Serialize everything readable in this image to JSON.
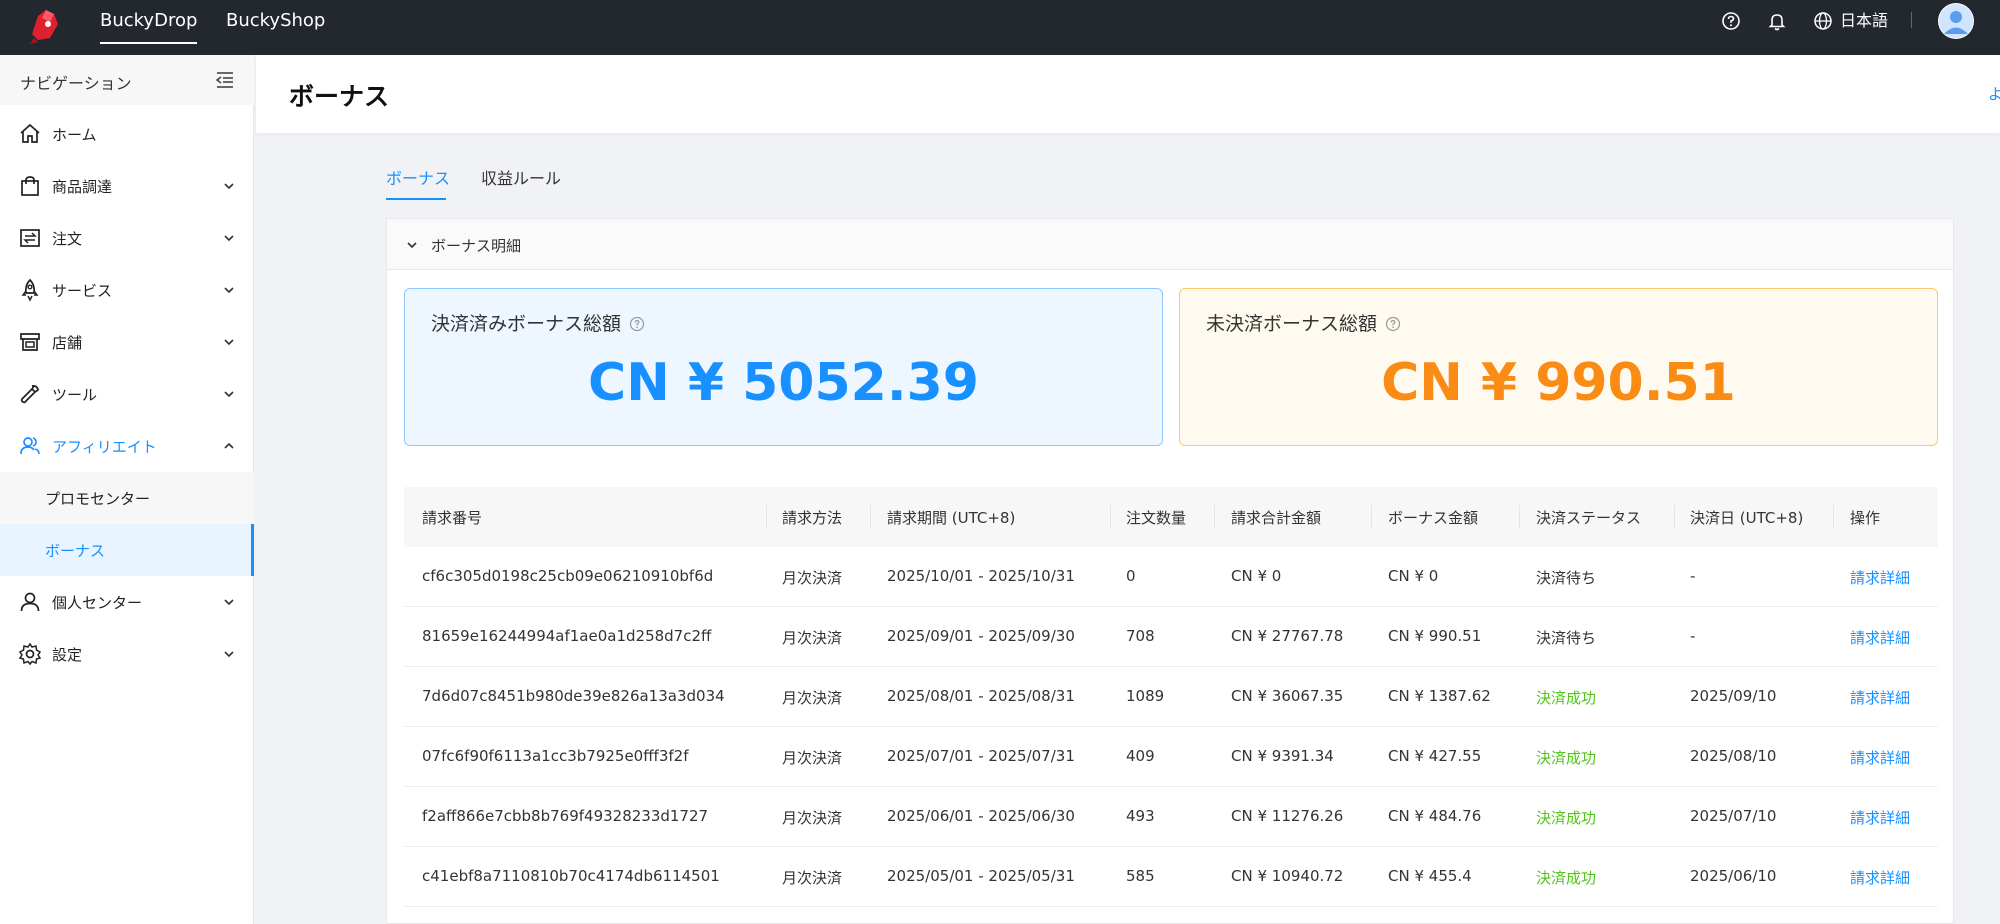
{
  "top_nav": {
    "items": [
      {
        "label": "BuckyDrop",
        "active": true
      },
      {
        "label": "BuckyShop",
        "active": false
      }
    ],
    "language": "日本語"
  },
  "sidebar": {
    "title": "ナビゲーション",
    "items": [
      {
        "label": "ホーム",
        "icon": "home-icon",
        "has_children": false
      },
      {
        "label": "商品調達",
        "icon": "shopping-bag-icon",
        "has_children": true
      },
      {
        "label": "注文",
        "icon": "order-icon",
        "has_children": true
      },
      {
        "label": "サービス",
        "icon": "rocket-icon",
        "has_children": true
      },
      {
        "label": "店舗",
        "icon": "store-icon",
        "has_children": true
      },
      {
        "label": "ツール",
        "icon": "wrench-icon",
        "has_children": true
      },
      {
        "label": "アフィリエイト",
        "icon": "affiliate-users-icon",
        "has_children": true,
        "expanded": true
      },
      {
        "label": "個人センター",
        "icon": "user-icon",
        "has_children": true
      },
      {
        "label": "設定",
        "icon": "gear-icon",
        "has_children": true
      }
    ],
    "affiliate_children": [
      {
        "label": "プロモセンター",
        "selected": false
      },
      {
        "label": "ボーナス",
        "selected": true
      }
    ]
  },
  "page": {
    "title": "ボーナス",
    "header_link": "よ"
  },
  "tabs": [
    {
      "label": "ボーナス",
      "active": true
    },
    {
      "label": "収益ルール",
      "active": false
    }
  ],
  "card": {
    "title": "ボーナス明細"
  },
  "stats": {
    "settled": {
      "label": "決済済みボーナス総額",
      "value": "CN ¥ 5052.39"
    },
    "unsettled": {
      "label": "未決済ボーナス総額",
      "value": "CN ¥ 990.51"
    }
  },
  "table": {
    "columns": [
      "請求番号",
      "請求方法",
      "請求期間 (UTC+8)",
      "注文数量",
      "請求合計金額",
      "ボーナス金額",
      "決済ステータス",
      "決済日 (UTC+8)",
      "操作"
    ],
    "rows": [
      {
        "id": "cf6c305d0198c25cb09e06210910bf6d",
        "method": "月次決済",
        "period": "2025/10/01 - 2025/10/31",
        "qty": "0",
        "total": "CN ¥ 0",
        "bonus": "CN ¥ 0",
        "status": "決済待ち",
        "date": "-",
        "action": "請求詳細"
      },
      {
        "id": "81659e16244994af1ae0a1d258d7c2ff",
        "method": "月次決済",
        "period": "2025/09/01 - 2025/09/30",
        "qty": "708",
        "total": "CN ¥ 27767.78",
        "bonus": "CN ¥ 990.51",
        "status": "決済待ち",
        "date": "-",
        "action": "請求詳細"
      },
      {
        "id": "7d6d07c8451b980de39e826a13a3d034",
        "method": "月次決済",
        "period": "2025/08/01 - 2025/08/31",
        "qty": "1089",
        "total": "CN ¥ 36067.35",
        "bonus": "CN ¥ 1387.62",
        "status": "決済成功",
        "date": "2025/09/10",
        "action": "請求詳細"
      },
      {
        "id": "07fc6f90f6113a1cc3b7925e0fff3f2f",
        "method": "月次決済",
        "period": "2025/07/01 - 2025/07/31",
        "qty": "409",
        "total": "CN ¥ 9391.34",
        "bonus": "CN ¥ 427.55",
        "status": "決済成功",
        "date": "2025/08/10",
        "action": "請求詳細"
      },
      {
        "id": "f2aff866e7cbb8b769f49328233d1727",
        "method": "月次決済",
        "period": "2025/06/01 - 2025/06/30",
        "qty": "493",
        "total": "CN ¥ 11276.26",
        "bonus": "CN ¥ 484.76",
        "status": "決済成功",
        "date": "2025/07/10",
        "action": "請求詳細"
      },
      {
        "id": "c41ebf8a7110810b70c4174db6114501",
        "method": "月次決済",
        "period": "2025/05/01 - 2025/05/31",
        "qty": "585",
        "total": "CN ¥ 10940.72",
        "bonus": "CN ¥ 455.4",
        "status": "決済成功",
        "date": "2025/06/10",
        "action": "請求詳細"
      }
    ]
  },
  "colors": {
    "accent": "#1890ff",
    "success": "#52c41a",
    "warning": "#fa8c16",
    "topbar": "#23272e"
  }
}
